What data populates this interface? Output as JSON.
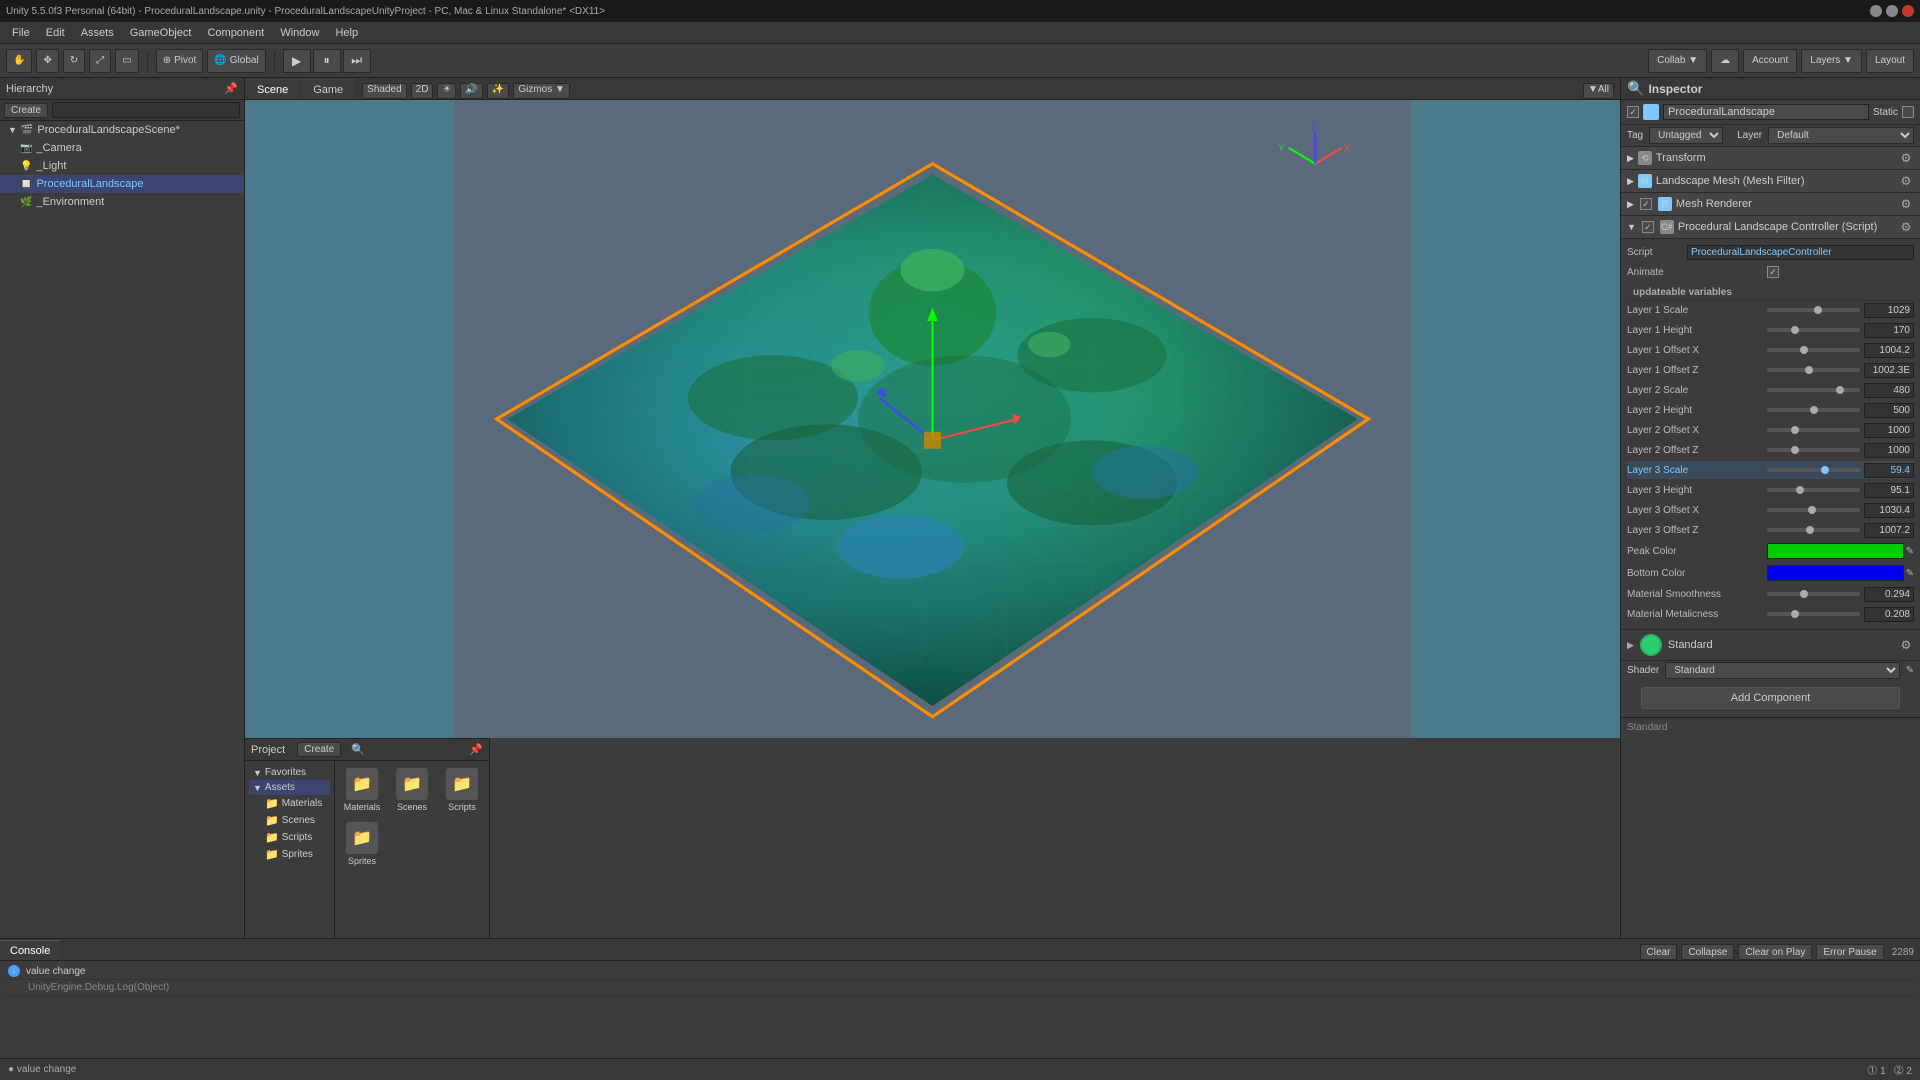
{
  "titlebar": {
    "title": "Unity 5.5.0f3 Personal (64bit) - ProceduralLandscape.unity - ProceduralLandscapeUnityProject - PC, Mac & Linux Standalone* <DX11>"
  },
  "menubar": {
    "items": [
      "File",
      "Edit",
      "Assets",
      "GameObject",
      "Component",
      "Window",
      "Help"
    ]
  },
  "toolbar": {
    "pivot_label": "Pivot",
    "global_label": "Global",
    "collab_label": "Collab ▼",
    "account_label": "Account",
    "layers_label": "Layers ▼",
    "layout_label": "Layout"
  },
  "hierarchy": {
    "title": "Hierarchy",
    "create_label": "Create",
    "items": [
      {
        "name": "ProceduralLandscapeScene*",
        "level": 0,
        "expanded": true,
        "icon": "scene"
      },
      {
        "name": "_Camera",
        "level": 1,
        "icon": "camera"
      },
      {
        "name": "_Light",
        "level": 1,
        "icon": "light"
      },
      {
        "name": "ProceduralLandscape",
        "level": 1,
        "icon": "mesh",
        "selected": true
      },
      {
        "name": "_Environment",
        "level": 1,
        "icon": "env"
      }
    ]
  },
  "scene": {
    "tabs": [
      "Scene",
      "Game"
    ],
    "active_tab": "Scene",
    "shading_label": "Shaded",
    "mode_label": "2D",
    "gizmos_label": "Gizmos ▼",
    "all_label": "▼All"
  },
  "inspector": {
    "title": "Inspector",
    "object_name": "ProceduralLandscape",
    "static_label": "Static",
    "tag_label": "Tag",
    "tag_value": "Untagged",
    "layer_label": "Layer",
    "layer_value": "Default",
    "components": [
      {
        "name": "Transform",
        "icon": "transform"
      },
      {
        "name": "Landscape Mesh (Mesh Filter)",
        "icon": "mesh"
      },
      {
        "name": "Mesh Renderer",
        "icon": "renderer"
      },
      {
        "name": "Procedural Landscape Controller (Script)",
        "icon": "script",
        "script_label": "Script",
        "script_value": "ProceduralLandscapeController",
        "animate_label": "Animate",
        "animate_checked": true,
        "section_label": "updateable variables",
        "properties": [
          {
            "label": "Layer 1 Scale",
            "value": "1029",
            "pct": 0.55,
            "highlight": false
          },
          {
            "label": "Layer 1 Height",
            "value": "170",
            "pct": 0.3,
            "highlight": false
          },
          {
            "label": "Layer 1 Offset X",
            "value": "1004.2",
            "pct": 0.4,
            "highlight": false
          },
          {
            "label": "Layer 1 Offset Z",
            "value": "1002.3E",
            "pct": 0.45,
            "highlight": false
          },
          {
            "label": "Layer 2 Scale",
            "value": "480",
            "pct": 0.78,
            "highlight": false
          },
          {
            "label": "Layer 2 Height",
            "value": "500",
            "pct": 0.5,
            "highlight": false
          },
          {
            "label": "Layer 2 Offset X",
            "value": "1000",
            "pct": 0.3,
            "highlight": false
          },
          {
            "label": "Layer 2 Offset Z",
            "value": "1000",
            "pct": 0.3,
            "highlight": false
          },
          {
            "label": "Layer 3 Scale",
            "value": "59.4",
            "pct": 0.62,
            "highlight": true
          },
          {
            "label": "Layer 3 Height",
            "value": "95.1",
            "pct": 0.35,
            "highlight": false
          },
          {
            "label": "Layer 3 Offset X",
            "value": "1030.4",
            "pct": 0.48,
            "highlight": false
          },
          {
            "label": "Layer 3 Offset Z",
            "value": "1007.2",
            "pct": 0.46,
            "highlight": false
          }
        ],
        "colors": [
          {
            "label": "Peak Color",
            "color": "#00cc00"
          },
          {
            "label": "Bottom Color",
            "color": "#0000ee"
          }
        ],
        "sliders2": [
          {
            "label": "Material Smoothness",
            "value": "0.294",
            "pct": 0.4
          },
          {
            "label": "Material Metalicness",
            "value": "0.208",
            "pct": 0.3
          }
        ]
      }
    ],
    "standard_material": {
      "name": "Standard",
      "shader_label": "Shader",
      "shader_value": "Standard"
    },
    "add_component_label": "Add Component"
  },
  "project": {
    "title": "Project",
    "create_label": "Create",
    "favorites": "Favorites",
    "assets": "Assets",
    "folders": [
      "Materials",
      "Scenes",
      "Scripts",
      "Sprites"
    ],
    "selected_folder": "Assets"
  },
  "console": {
    "title": "Console",
    "btns": [
      "Clear",
      "Collapse",
      "Clear on Play",
      "Error Pause"
    ],
    "lines": [
      {
        "type": "info",
        "text": "value change"
      },
      {
        "type": "info",
        "text": "UnityEngine.Debug.Log(Object)"
      }
    ],
    "count": "2289"
  },
  "status_bar": {
    "message": "● value change",
    "count1": "⓵ 1",
    "count2": "⓶ 2"
  }
}
